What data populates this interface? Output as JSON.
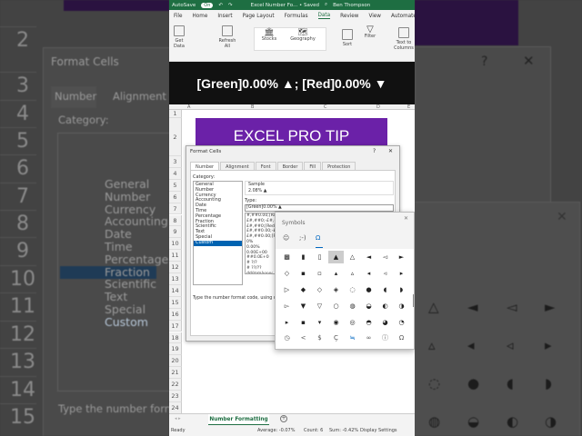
{
  "title_bar": {
    "autosave": "AutoSave",
    "toggle": "On",
    "doc": "Excel Number Fo... • Saved",
    "user": "Ben Thompson"
  },
  "ribbon_tabs": [
    "File",
    "Home",
    "Insert",
    "Page Layout",
    "Formulas",
    "Data",
    "Review",
    "View",
    "Automate"
  ],
  "ribbon": {
    "get_data": "Get Data",
    "refresh_all": "Refresh All",
    "stocks": "Stocks",
    "geography": "Geography",
    "sort": "Sort",
    "filter": "Filter",
    "text_to_columns": "Text to Columns"
  },
  "caption": "[Green]0.00% ▲; [Red]0.00% ▼",
  "columns": [
    "A",
    "B",
    "C",
    "D",
    "E"
  ],
  "banner": "EXCEL PRO TIP",
  "rows": [
    "1",
    "2",
    "3",
    "4",
    "5",
    "6",
    "7",
    "8",
    "9",
    "10",
    "11",
    "12",
    "13",
    "14",
    "15",
    "16",
    "17",
    "18",
    "19",
    "20",
    "21",
    "22",
    "23",
    "24"
  ],
  "format_cells": {
    "title": "Format Cells",
    "help": "?",
    "close": "✕",
    "tabs": [
      "Number",
      "Alignment",
      "Font",
      "Border",
      "Fill",
      "Protection"
    ],
    "category_label": "Category:",
    "categories": [
      "General",
      "Number",
      "Currency",
      "Accounting",
      "Date",
      "Time",
      "Percentage",
      "Fraction",
      "Scientific",
      "Text",
      "Special",
      "Custom"
    ],
    "selected_category": "Custom",
    "sample_label": "Sample",
    "sample_value": "2.08% ▲",
    "type_label": "Type:",
    "type_value": "[Green]0.00% ▲",
    "formats": [
      "#,##0.00;[Red]",
      "£#,##0;-£#,##",
      "£#,##0;[Red]-",
      "£#,##0.00;-£#",
      "£#,##0.00;[Re",
      "0%",
      "0.00%",
      "0.00E+00",
      "##0.0E+0",
      "# ?/?",
      "# ??/??",
      "dd/mm/yyyy"
    ],
    "hint": "Type the number format code, using one"
  },
  "symbols": {
    "title": "Symbols",
    "close": "✕",
    "tabs": [
      "☺",
      ";-)",
      "Ω"
    ],
    "grid": [
      [
        "▩",
        "▮",
        "▯",
        "▲",
        "△",
        "◄",
        "◅",
        "►"
      ],
      [
        "◇",
        "▪",
        "▫",
        "▴",
        "▵",
        "◂",
        "◃",
        "▸"
      ],
      [
        "▷",
        "◆",
        "◇",
        "◈",
        "◌",
        "●",
        "◖",
        "◗"
      ],
      [
        "▻",
        "▼",
        "▽",
        "○",
        "◍",
        "◒",
        "◐",
        "◑"
      ],
      [
        "▸",
        "▪",
        "▾",
        "◉",
        "◎",
        "◓",
        "◕",
        "◔"
      ]
    ],
    "categories": [
      "◷",
      "<",
      "$",
      "Ç",
      "≒",
      "∞",
      "ⓘ",
      "Ω"
    ]
  },
  "sheet_tab": "Number Formatting",
  "add_sheet": "+",
  "status": {
    "ready": "Ready",
    "average": "Average: -0.07%",
    "count": "Count: 6",
    "sum": "Sum: -0.42%",
    "display": "Display Settings"
  },
  "colors": {
    "excel_green": "#1e6e42",
    "banner_purple": "#6b21a8",
    "selection_blue": "#0063b1"
  }
}
